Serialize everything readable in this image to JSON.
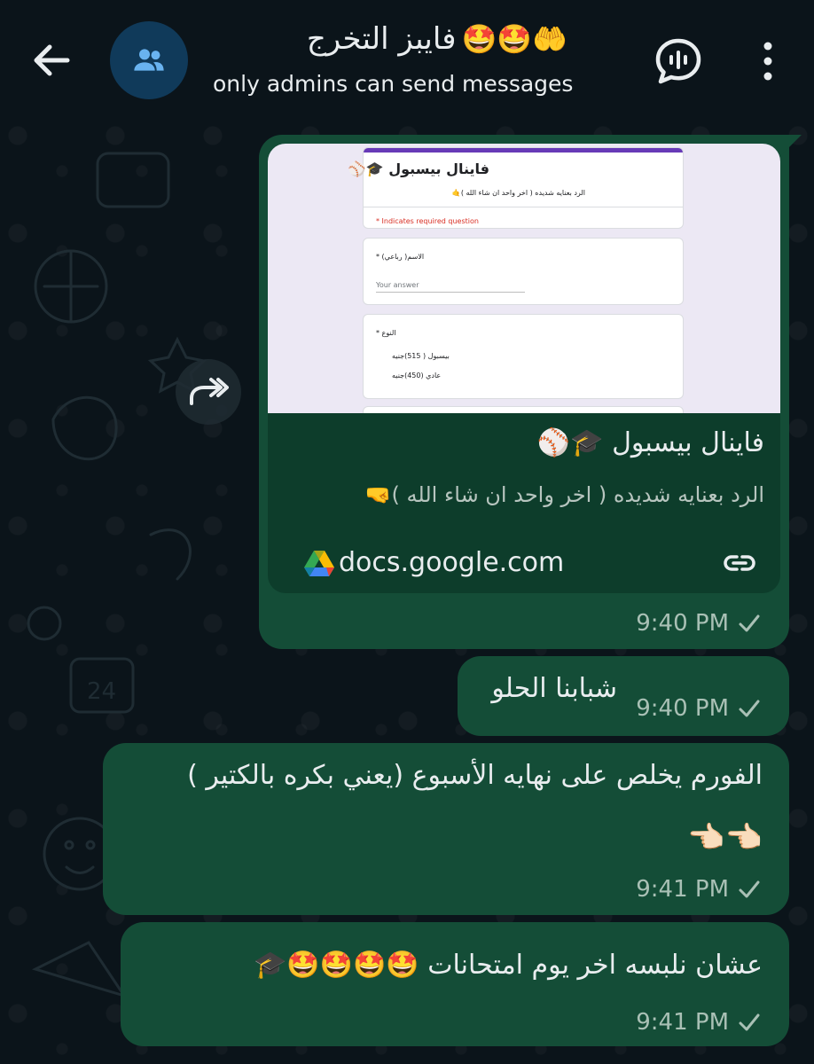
{
  "header": {
    "title": "فايبز التخرج",
    "title_emojis": "🤲🤩🤩",
    "subtitle": "only admins can send messages",
    "icons": [
      "back-arrow-icon",
      "group-avatar-icon",
      "voice-chat-icon",
      "more-vert-icon"
    ]
  },
  "messages": [
    {
      "type": "link",
      "preview": {
        "form_title": "فاينال بيسبول 🎓⚾",
        "form_desc": "الرد بعنايه شديده ( اخر واحد ان شاء الله )🤙",
        "required_note": "* Indicates required question",
        "q1_label": "الاسم( رباعي) *",
        "q1_placeholder": "Your answer",
        "q2_label": "النوع *",
        "q2_opt1": "بيسبول ( 515)جنيه",
        "q2_opt2": "عادي (450)جنيه",
        "title": "فاينال بيسبول 🎓⚾",
        "description": "الرد بعنايه شديده ( اخر واحد ان شاء الله )🤜",
        "domain": "docs.google.com"
      },
      "time": "9:40 PM"
    },
    {
      "type": "text",
      "text": "شبابنا الحلو",
      "time": "9:40 PM"
    },
    {
      "type": "text",
      "line1": "الفورم يخلص على نهايه الأسبوع (يعني بكره بالكتير )",
      "line2": "👈🏻👈🏻",
      "time": "9:41 PM"
    },
    {
      "type": "text",
      "text": "عشان نلبسه اخر يوم امتحانات 🤩🤩🤩🤩🎓",
      "time": "9:41 PM"
    }
  ],
  "colors": {
    "background": "#0b141a",
    "outgoing_bubble": "#144d37",
    "link_card": "#0d3d2b",
    "avatar": "#103a5a",
    "meta_text": "#a9c0b5"
  }
}
